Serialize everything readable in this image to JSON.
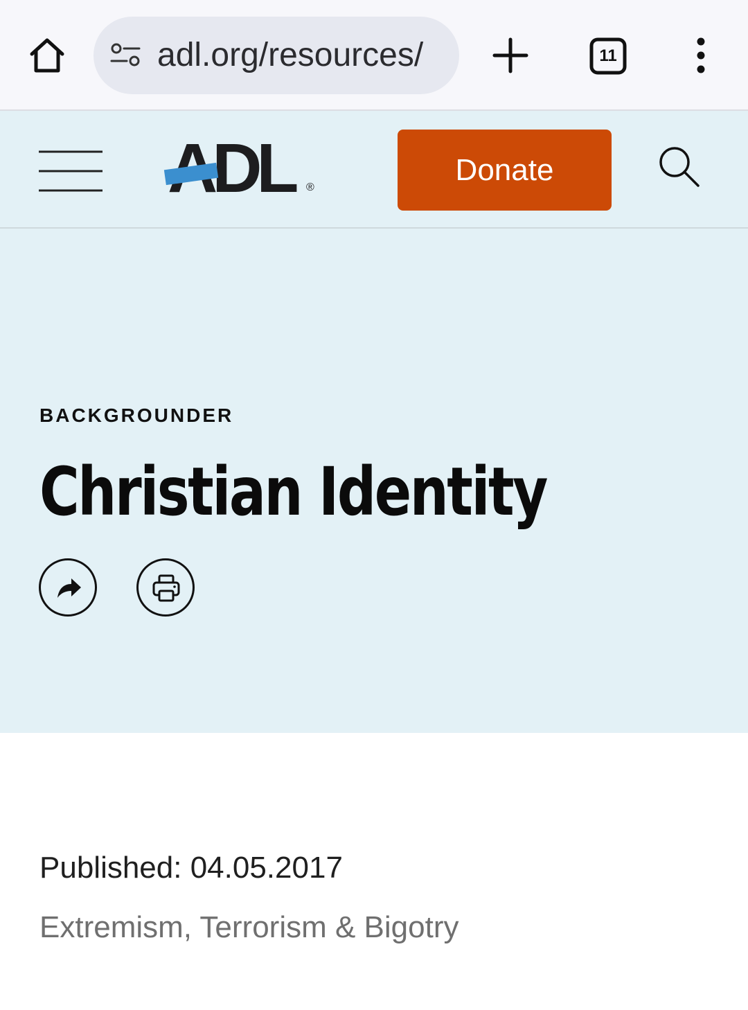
{
  "browser": {
    "url": "adl.org/resources/",
    "tab_count": "11",
    "icons": [
      "home-icon",
      "site-settings-icon",
      "new-tab-icon",
      "tabs-icon",
      "more-menu-icon"
    ]
  },
  "header": {
    "logo_text": "ADL",
    "logo_reg": "®",
    "donate_label": "Donate",
    "accent_color": "#cc4a06",
    "icons": [
      "hamburger-icon",
      "search-icon"
    ]
  },
  "hero": {
    "kicker": "BACKGROUNDER",
    "title": "Christian Identity",
    "actions": [
      "share-icon",
      "print-icon"
    ],
    "background_color": "#e3f1f6"
  },
  "meta": {
    "published": "Published: 04.05.2017",
    "topic": "Extremism, Terrorism & Bigotry"
  }
}
